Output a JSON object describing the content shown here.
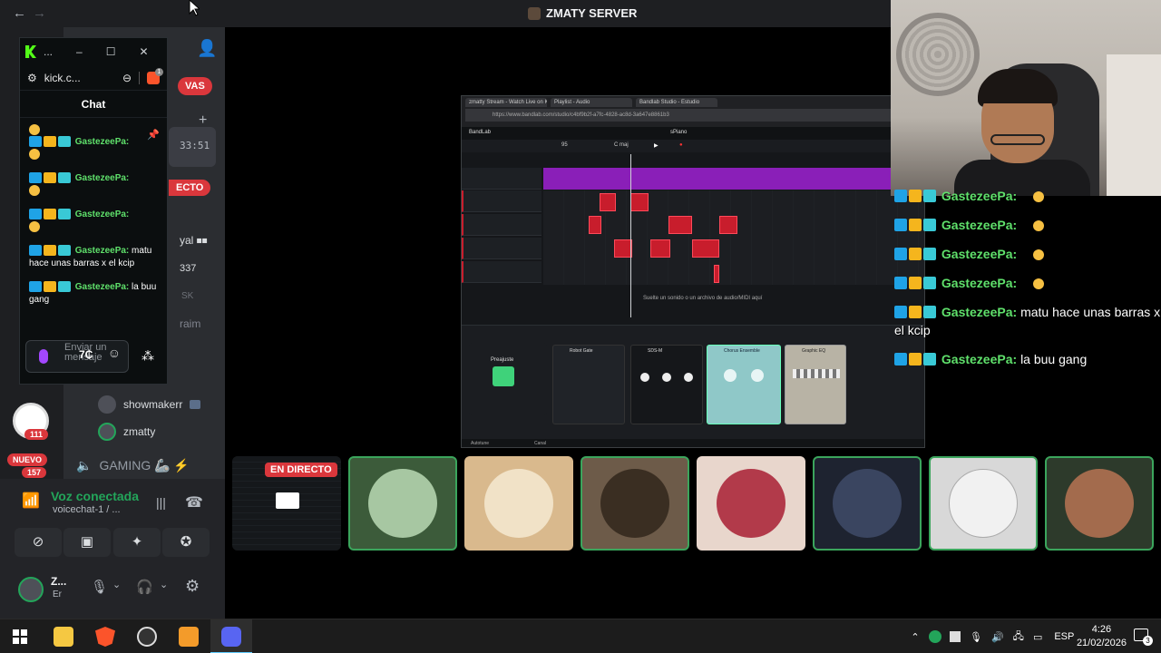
{
  "window": {
    "title": "ZMATY SERVER",
    "back": "←",
    "forward": "→"
  },
  "left_partial": {
    "pill_top": "VAS",
    "timer": "33:51",
    "live_partial": "ECTO",
    "text_partial_1": "yal ⏹⏹",
    "text_partial_2": "337",
    "text_partial_3": "SK",
    "text_partial_4": "raim"
  },
  "kick": {
    "url": "kick.c...",
    "title_dots": "...",
    "chat_title": "Chat",
    "notif_count": "1",
    "messages": [
      {
        "user": "GastezeePa:",
        "text": ""
      },
      {
        "user": "GastezeePa:",
        "text": ""
      },
      {
        "user": "GastezeePa:",
        "text": ""
      },
      {
        "user": "GastezeePa:",
        "text": "matu hace unas barras x el kcip"
      },
      {
        "user": "GastezeePa:",
        "text": "la buu gang"
      }
    ],
    "input_placeholder": "Enviar un mensaje",
    "input_extra": "7₵"
  },
  "channel_users": [
    {
      "name": "showmakerr"
    },
    {
      "name": "zmatty"
    }
  ],
  "gaming_channel": "GAMING 🦾 ⚡",
  "server_badges": {
    "count_111": "111",
    "nuevo": "NUEVO",
    "count_157": "157"
  },
  "voice": {
    "status": "Voz conectada",
    "channel": "voicechat-1 / ...",
    "user_name": "Z...",
    "user_sub": "Er"
  },
  "share": {
    "tabs": [
      "zmatty Stream - Watch Live on K",
      "Playlist - Audio",
      "Bandlab Studio - Estudio"
    ],
    "url": "https://www.bandlab.com/studio/c4bf9b2f-a7fc-4828-ac8d-3a647e8861b3",
    "app": "BandLab",
    "project": "sPiano",
    "bpm": "95",
    "key": "C maj",
    "hint": "Suelte un sonido o un archivo de audio/MIDI aquí",
    "fx": [
      "Preajuste",
      "Robot Gate",
      "SDS-M",
      "Chorus Ensemble",
      "Graphic EQ"
    ],
    "bottom_left": "Autotune",
    "bottom_right": "Canal"
  },
  "overlay_chat": [
    {
      "user": "GastezeePa:",
      "text": ""
    },
    {
      "user": "GastezeePa:",
      "text": ""
    },
    {
      "user": "GastezeePa:",
      "text": ""
    },
    {
      "user": "GastezeePa:",
      "text": ""
    },
    {
      "user": "GastezeePa:",
      "text": "matu hace unas barras x el kcip"
    },
    {
      "user": "GastezeePa:",
      "text": "la buu gang"
    }
  ],
  "live_label": "EN DIRECTO",
  "participants": [
    {
      "speaking": false,
      "color": "#0f1113"
    },
    {
      "speaking": true,
      "color": "#3c5b3a"
    },
    {
      "speaking": false,
      "color": "#d9b98d"
    },
    {
      "speaking": true,
      "color": "#6d5b49"
    },
    {
      "speaking": false,
      "color": "#e8d6cc"
    },
    {
      "speaking": true,
      "color": "#2a3147"
    },
    {
      "speaking": true,
      "color": "#d8d8d8"
    },
    {
      "speaking": true,
      "color": "#2d3a2b"
    }
  ],
  "taskbar": {
    "lang": "ESP",
    "time": "4:26",
    "date": "21/02/2026",
    "notif": "3"
  }
}
